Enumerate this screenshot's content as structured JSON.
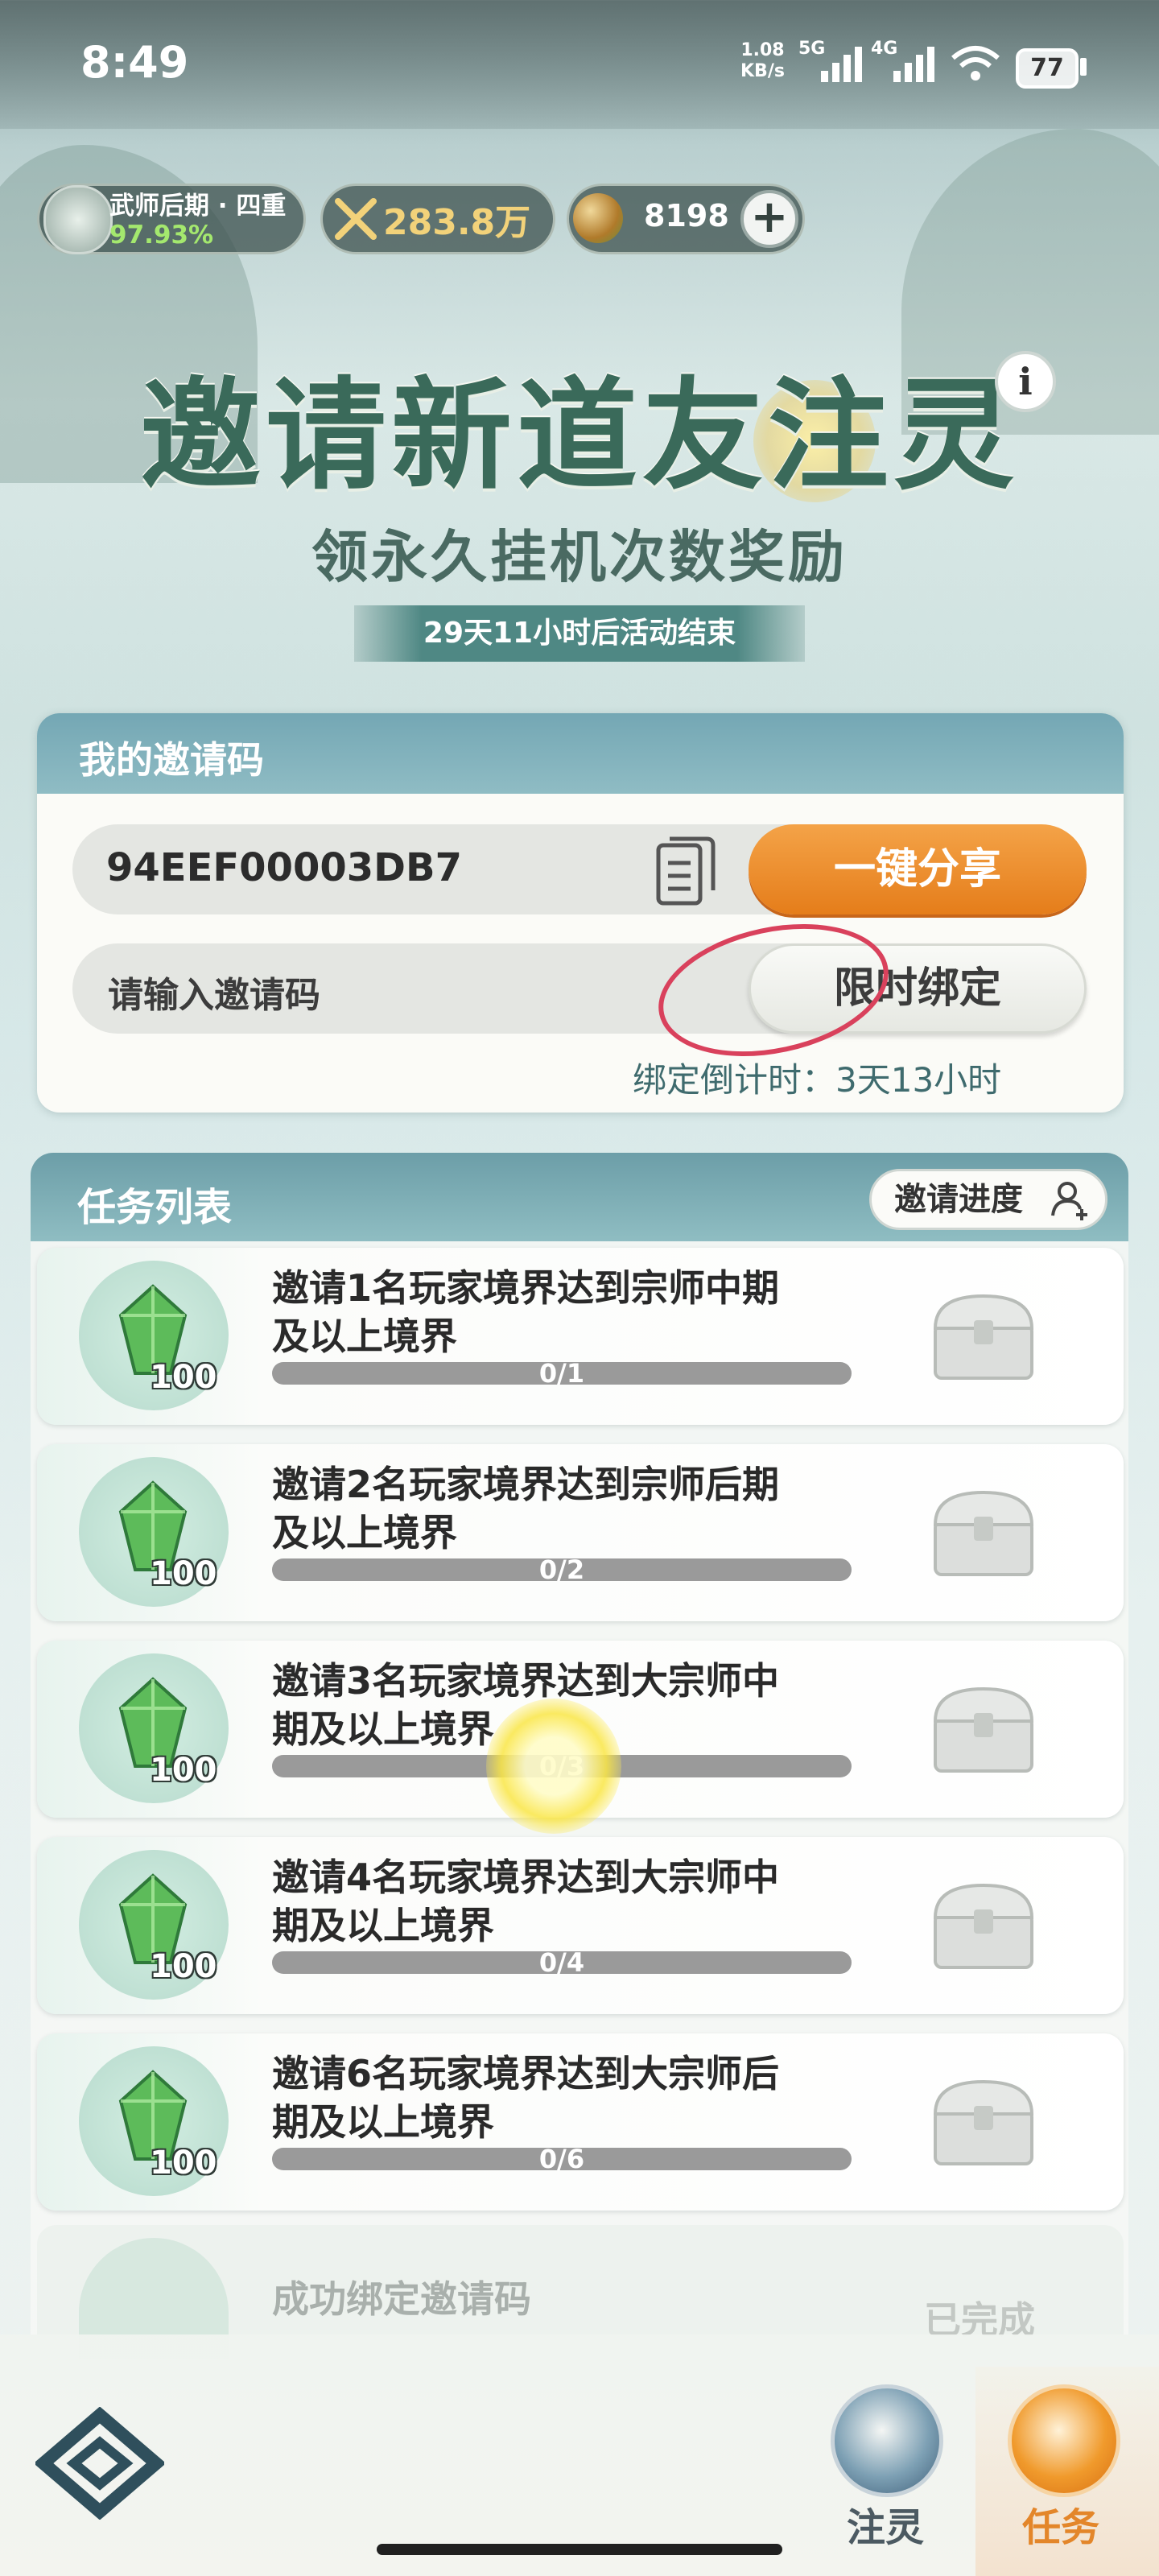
{
  "status_bar": {
    "time": "8:49",
    "net_speed_value": "1.08",
    "net_speed_unit": "KB/s",
    "net_5g": "5G",
    "net_4g": "4G",
    "battery": "77"
  },
  "resources": {
    "rank_title": "武师后期 · 四重",
    "rank_progress": "97.93%",
    "power": "283.8万",
    "jade": "8198",
    "add_symbol": "+"
  },
  "banner": {
    "title": "邀请新道友注灵",
    "subtitle": "领永久挂机次数奖励",
    "countdown": "29天11小时后活动结束",
    "info_symbol": "i"
  },
  "invite_card": {
    "title": "我的邀请码",
    "code": "94EEF00003DB7",
    "share_label": "一键分享",
    "input_placeholder": "请输入邀请码",
    "bind_label": "限时绑定",
    "bind_countdown": "绑定倒计时：3天13小时"
  },
  "task_list": {
    "title": "任务列表",
    "progress_label": "邀请进度",
    "tasks": [
      {
        "line1": "邀请1名玩家境界达到宗师中期",
        "line2": "及以上境界",
        "progress": "0/1",
        "reward_qty": "100",
        "done": 0,
        "total": 1
      },
      {
        "line1": "邀请2名玩家境界达到宗师后期",
        "line2": "及以上境界",
        "progress": "0/2",
        "reward_qty": "100",
        "done": 0,
        "total": 2
      },
      {
        "line1": "邀请3名玩家境界达到大宗师中",
        "line2": "期及以上境界",
        "progress": "0/3",
        "reward_qty": "100",
        "done": 0,
        "total": 3
      },
      {
        "line1": "邀请4名玩家境界达到大宗师中",
        "line2": "期及以上境界",
        "progress": "0/4",
        "reward_qty": "100",
        "done": 0,
        "total": 4
      },
      {
        "line1": "邀请6名玩家境界达到大宗师后",
        "line2": "期及以上境界",
        "progress": "0/6",
        "reward_qty": "100",
        "done": 0,
        "total": 6
      }
    ],
    "completed_task": {
      "text": "成功绑定邀请码",
      "status": "已完成"
    }
  },
  "bottom_nav": {
    "items": [
      {
        "label": "注灵",
        "icon": "leaf-icon",
        "active": false
      },
      {
        "label": "任务",
        "icon": "scroll-icon",
        "active": true
      }
    ]
  },
  "colors": {
    "accent_orange": "#e57d1a",
    "header_teal": "#74a7b4",
    "annotation_red": "#d9415c",
    "active_nav": "#e3862a"
  }
}
